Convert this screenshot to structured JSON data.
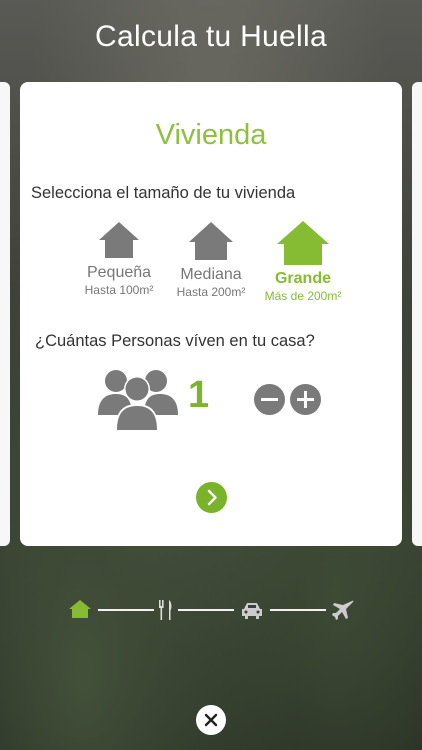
{
  "header": {
    "title": "Calcula tu Huella"
  },
  "card": {
    "title": "Vivienda",
    "size_question": "Selecciona el tamaño de tu vivienda",
    "sizes": [
      {
        "name": "Pequeña",
        "sub": "Hasta 100m²",
        "selected": false
      },
      {
        "name": "Mediana",
        "sub": "Hasta 200m²",
        "selected": false
      },
      {
        "name": "Grande",
        "sub": "Más de 200m²",
        "selected": true
      }
    ],
    "people_question": "¿Cuántas Personas víven en tu casa?",
    "people_count": "1"
  },
  "progress": {
    "steps": [
      "home-icon",
      "fork-knife-icon",
      "car-icon",
      "airplane-icon"
    ],
    "active_step": 0
  },
  "colors": {
    "accent_green": "#86bb34",
    "icon_gray": "#7a7a7a"
  }
}
